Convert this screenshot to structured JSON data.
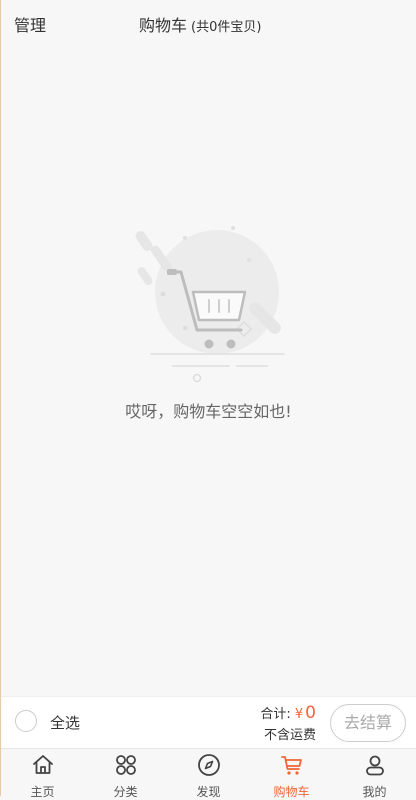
{
  "header": {
    "manage_label": "管理",
    "title": "购物车",
    "count_text": "(共0件宝贝)"
  },
  "empty_state": {
    "message": "哎呀，购物车空空如也!",
    "icon": "empty-cart-illustration"
  },
  "checkout": {
    "select_all_label": "全选",
    "total_label": "合计:",
    "currency": "¥",
    "total_value": "0",
    "shipping_note": "不含运费",
    "checkout_label": "去结算"
  },
  "tabbar": {
    "items": [
      {
        "label": "主页",
        "icon": "home-icon"
      },
      {
        "label": "分类",
        "icon": "category-icon"
      },
      {
        "label": "发现",
        "icon": "compass-icon"
      },
      {
        "label": "购物车",
        "icon": "cart-icon",
        "active": true
      },
      {
        "label": "我的",
        "icon": "user-icon"
      }
    ],
    "active_color": "#f0663a"
  }
}
